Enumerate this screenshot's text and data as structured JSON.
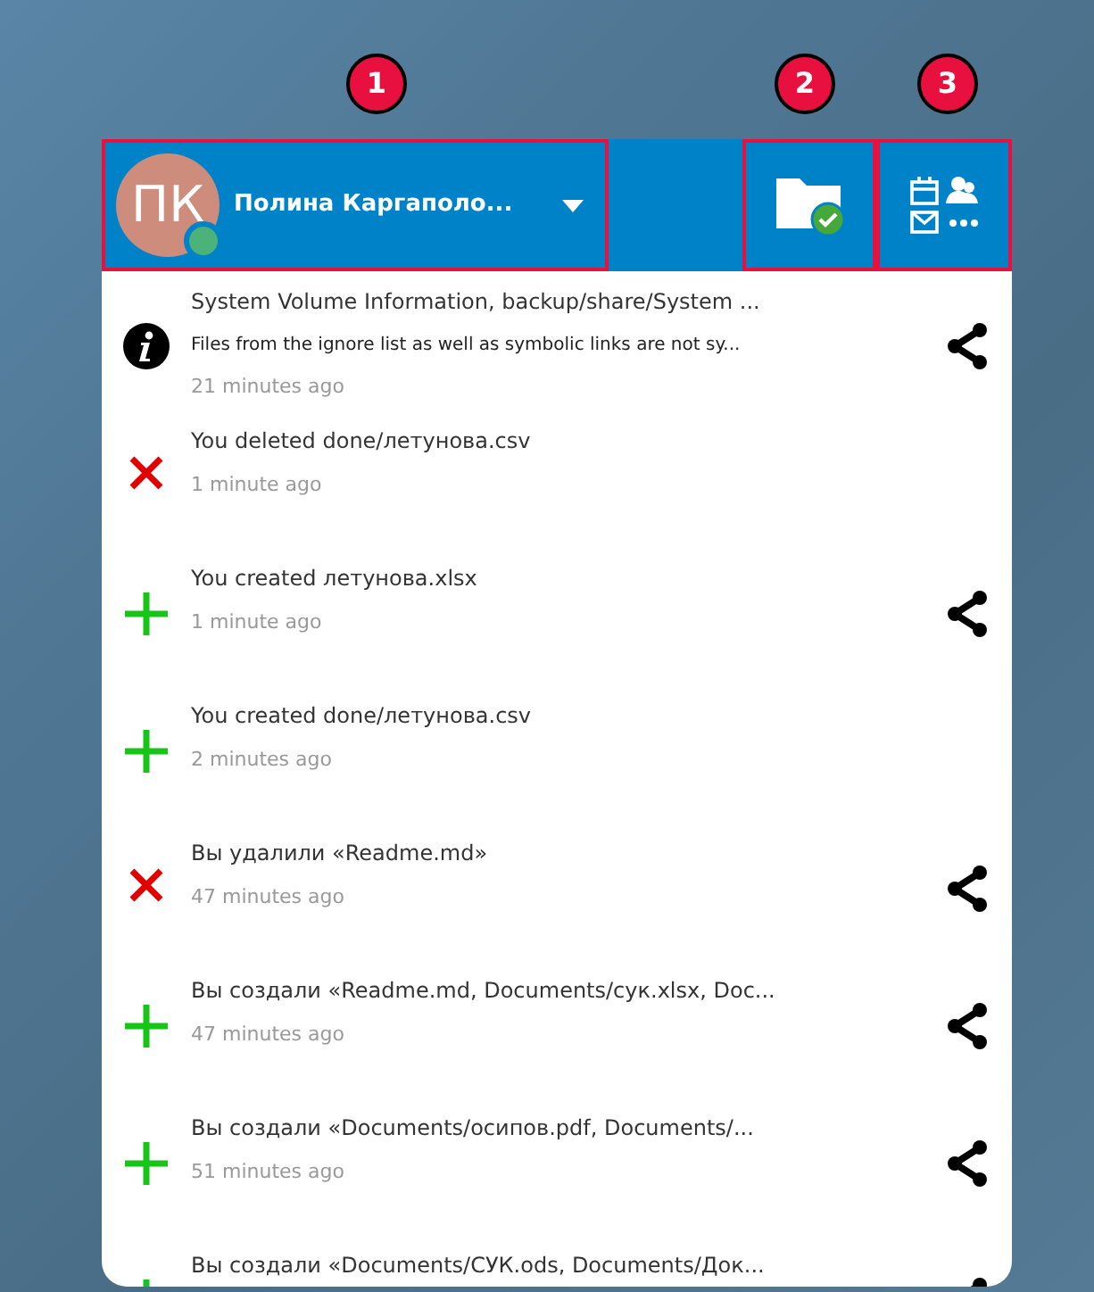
{
  "callouts": [
    "1",
    "2",
    "3"
  ],
  "account": {
    "initials": "ПК",
    "name": "Полина Каргаполо...",
    "online": true
  },
  "sync_status": {
    "ok": true
  },
  "activities": [
    {
      "kind": "info",
      "title": "System Volume Information, backup/share/System ...",
      "message": "Files from the ignore list as well as symbolic links are not sy...",
      "time": "21 minutes ago",
      "share": true
    },
    {
      "kind": "deleted",
      "title": "You deleted done/летунова.csv",
      "time": "1 minute ago",
      "share": false
    },
    {
      "kind": "added",
      "title": "You created летунова.xlsx",
      "time": "1 minute ago",
      "share": true
    },
    {
      "kind": "added",
      "title": "You created done/летунова.csv",
      "time": "2 minutes ago",
      "share": false
    },
    {
      "kind": "deleted",
      "title": "Вы удалили «Readme.md»",
      "time": "47 minutes ago",
      "share": true
    },
    {
      "kind": "added",
      "title": "Вы создали «Readme.md, Documents/сук.xlsx, Doc...",
      "time": "47 minutes ago",
      "share": true
    },
    {
      "kind": "added",
      "title": "Вы создали «Documents/осипов.pdf, Documents/...",
      "time": "51 minutes ago",
      "share": true
    },
    {
      "kind": "added",
      "title": "Вы создали «Documents/СУК.ods, Documents/Док...",
      "share": true
    }
  ]
}
